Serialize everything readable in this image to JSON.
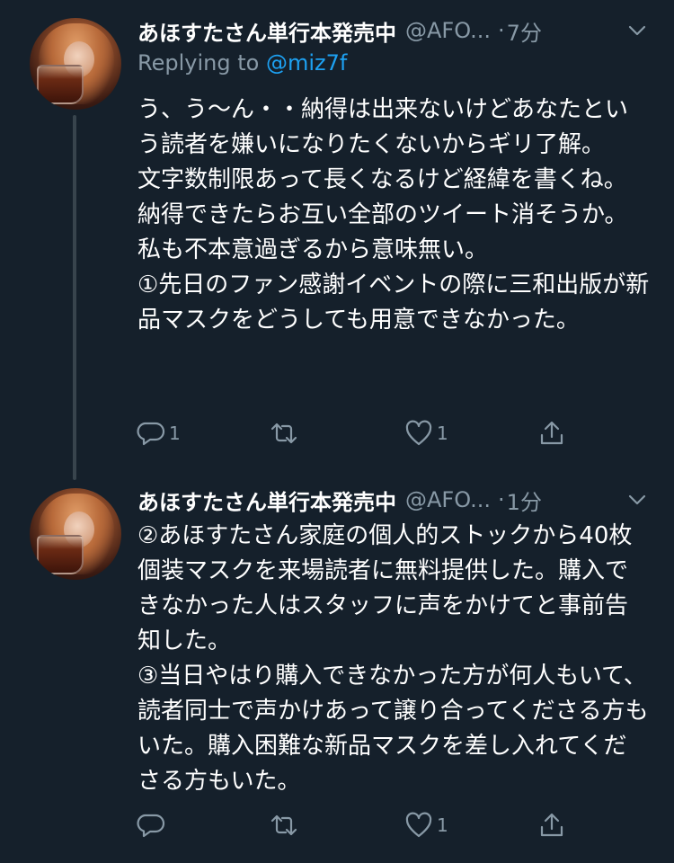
{
  "tweets": [
    {
      "display_name": "あほすたさん単行本発売中",
      "handle": "@AFO...",
      "separator": "·",
      "time": "7分",
      "replying_prefix": "Replying to ",
      "replying_to": "@miz7f",
      "text": "う、う〜ん・・納得は出来ないけどあなたという読者を嫌いになりたくないからギリ了解。\n文字数制限あって長くなるけど経緯を書くね。納得できたらお互い全部のツイート消そうか。私も不本意過ぎるから意味無い。\n①先日のファン感謝イベントの際に三和出版が新品マスクをどうしても用意できなかった。",
      "reply_count": "1",
      "retweet_count": "",
      "like_count": "1"
    },
    {
      "display_name": "あほすたさん単行本発売中",
      "handle": "@AFO...",
      "separator": "·",
      "time": "1分",
      "text": "②あほすたさん家庭の個人的ストックから40枚個装マスクを来場読者に無料提供した。購入できなかった人はスタッフに声をかけてと事前告知した。\n③当日やはり購入できなかった方が何人もいて、読者同士で声かけあって譲り合ってくださる方もいた。購入困難な新品マスクを差し入れてくださる方もいた。",
      "reply_count": "",
      "retweet_count": "",
      "like_count": "1"
    }
  ],
  "icons": {
    "reply": "reply-icon",
    "retweet": "retweet-icon",
    "like": "heart-icon",
    "share": "share-icon",
    "menu": "chevron-down-icon"
  },
  "colors": {
    "background": "#15202b",
    "secondary_text": "#8899a6",
    "link": "#1da1f2",
    "thread_line": "#38444d"
  }
}
